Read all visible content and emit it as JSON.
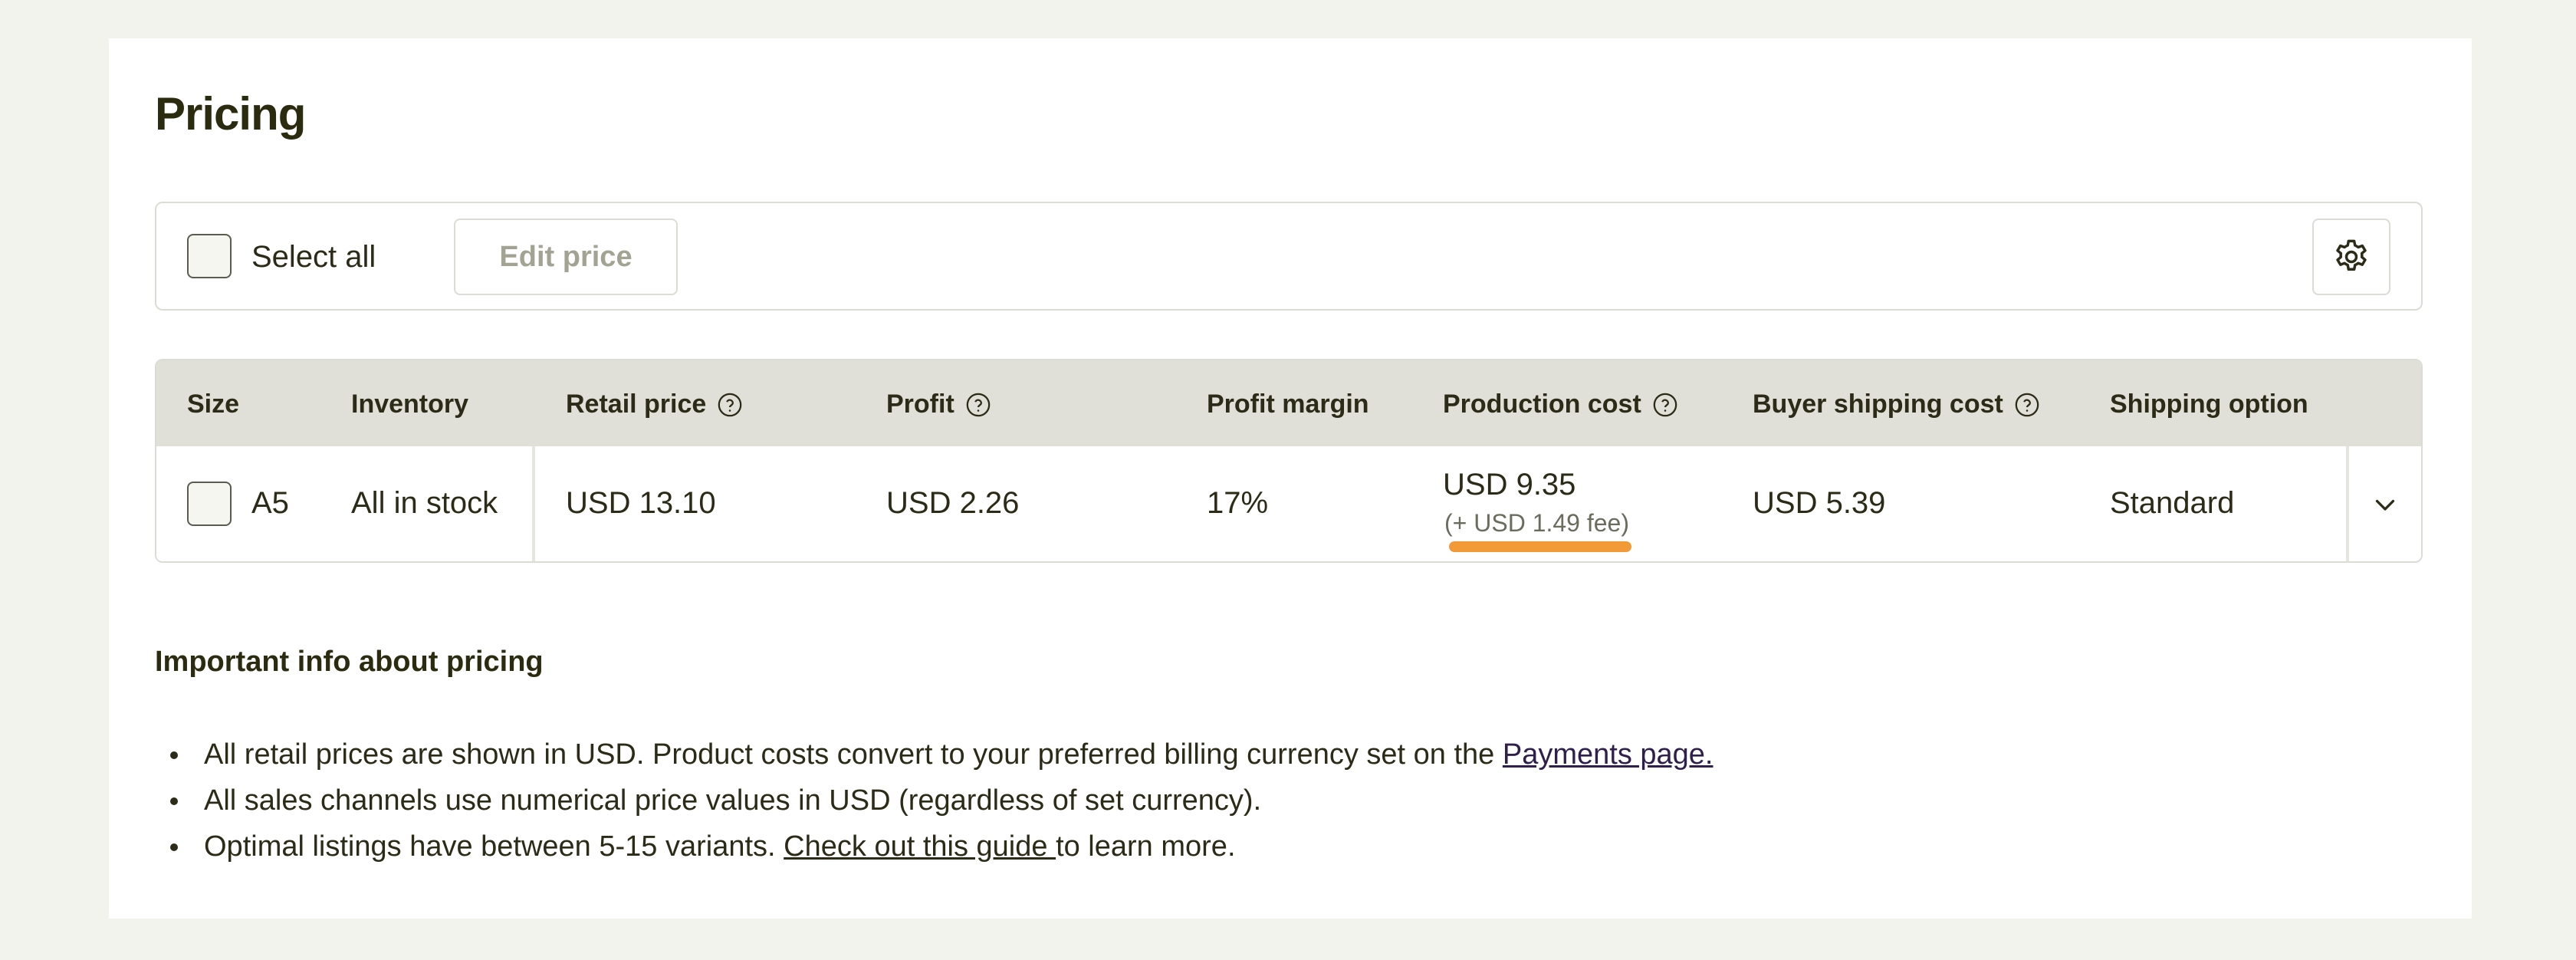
{
  "page": {
    "title": "Pricing"
  },
  "toolbar": {
    "select_all_label": "Select all",
    "edit_price_label": "Edit price",
    "settings_icon": "gear-icon"
  },
  "table": {
    "headers": {
      "size": "Size",
      "inventory": "Inventory",
      "retail_price": "Retail price",
      "profit": "Profit",
      "profit_margin": "Profit margin",
      "production_cost": "Production cost",
      "buyer_shipping_cost": "Buyer shipping cost",
      "shipping_option": "Shipping option"
    },
    "rows": [
      {
        "size": "A5",
        "inventory": "All in stock",
        "retail_price": "USD 13.10",
        "profit": "USD 2.26",
        "profit_margin": "17%",
        "production_cost": "USD 9.35",
        "production_fee": "(+ USD 1.49 fee)",
        "buyer_shipping_cost": "USD 5.39",
        "shipping_option": "Standard"
      }
    ]
  },
  "info": {
    "heading": "Important info about pricing",
    "items": [
      {
        "text": "All retail prices are shown in USD. Product costs convert to your preferred billing currency set on the ",
        "link": "Payments page.",
        "after": ""
      },
      {
        "text": "All sales channels use numerical price values in USD (regardless of set currency).",
        "link": "",
        "after": ""
      },
      {
        "text": "Optimal listings have between 5-15 variants. ",
        "link": "Check out this guide ",
        "after": "to learn more."
      }
    ]
  },
  "colors": {
    "accent_underline": "#f29a38",
    "header_bg": "#e0e0d8",
    "page_bg": "#f3f3ee"
  }
}
